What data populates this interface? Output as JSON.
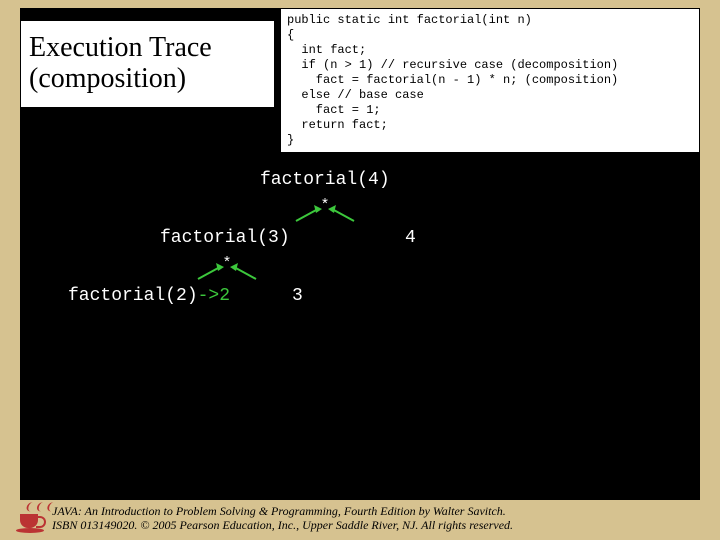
{
  "title": {
    "line1": "Execution Trace",
    "line2": "(composition)"
  },
  "code": {
    "l1": "public static int factorial(int n)",
    "l2": "{",
    "l3": "  int fact;",
    "l4": "  if (n > 1) // recursive case (decomposition)",
    "l5": "    fact = factorial(n - 1) * n; (composition)",
    "l6": "  else // base case",
    "l7": "    fact = 1;",
    "l8": "  return fact;",
    "l9": "}"
  },
  "trace": {
    "node_4": "factorial(4)",
    "node_3": "factorial(3)",
    "node_2": "factorial(2)",
    "result_2": "->2",
    "op": "*",
    "right_4": "4",
    "right_3": "3"
  },
  "footer": {
    "line1": "JAVA: An Introduction to Problem Solving & Programming, Fourth Edition by Walter Savitch.",
    "line2": "ISBN 013149020. © 2005 Pearson Education, Inc., Upper Saddle River, NJ. All rights reserved."
  }
}
